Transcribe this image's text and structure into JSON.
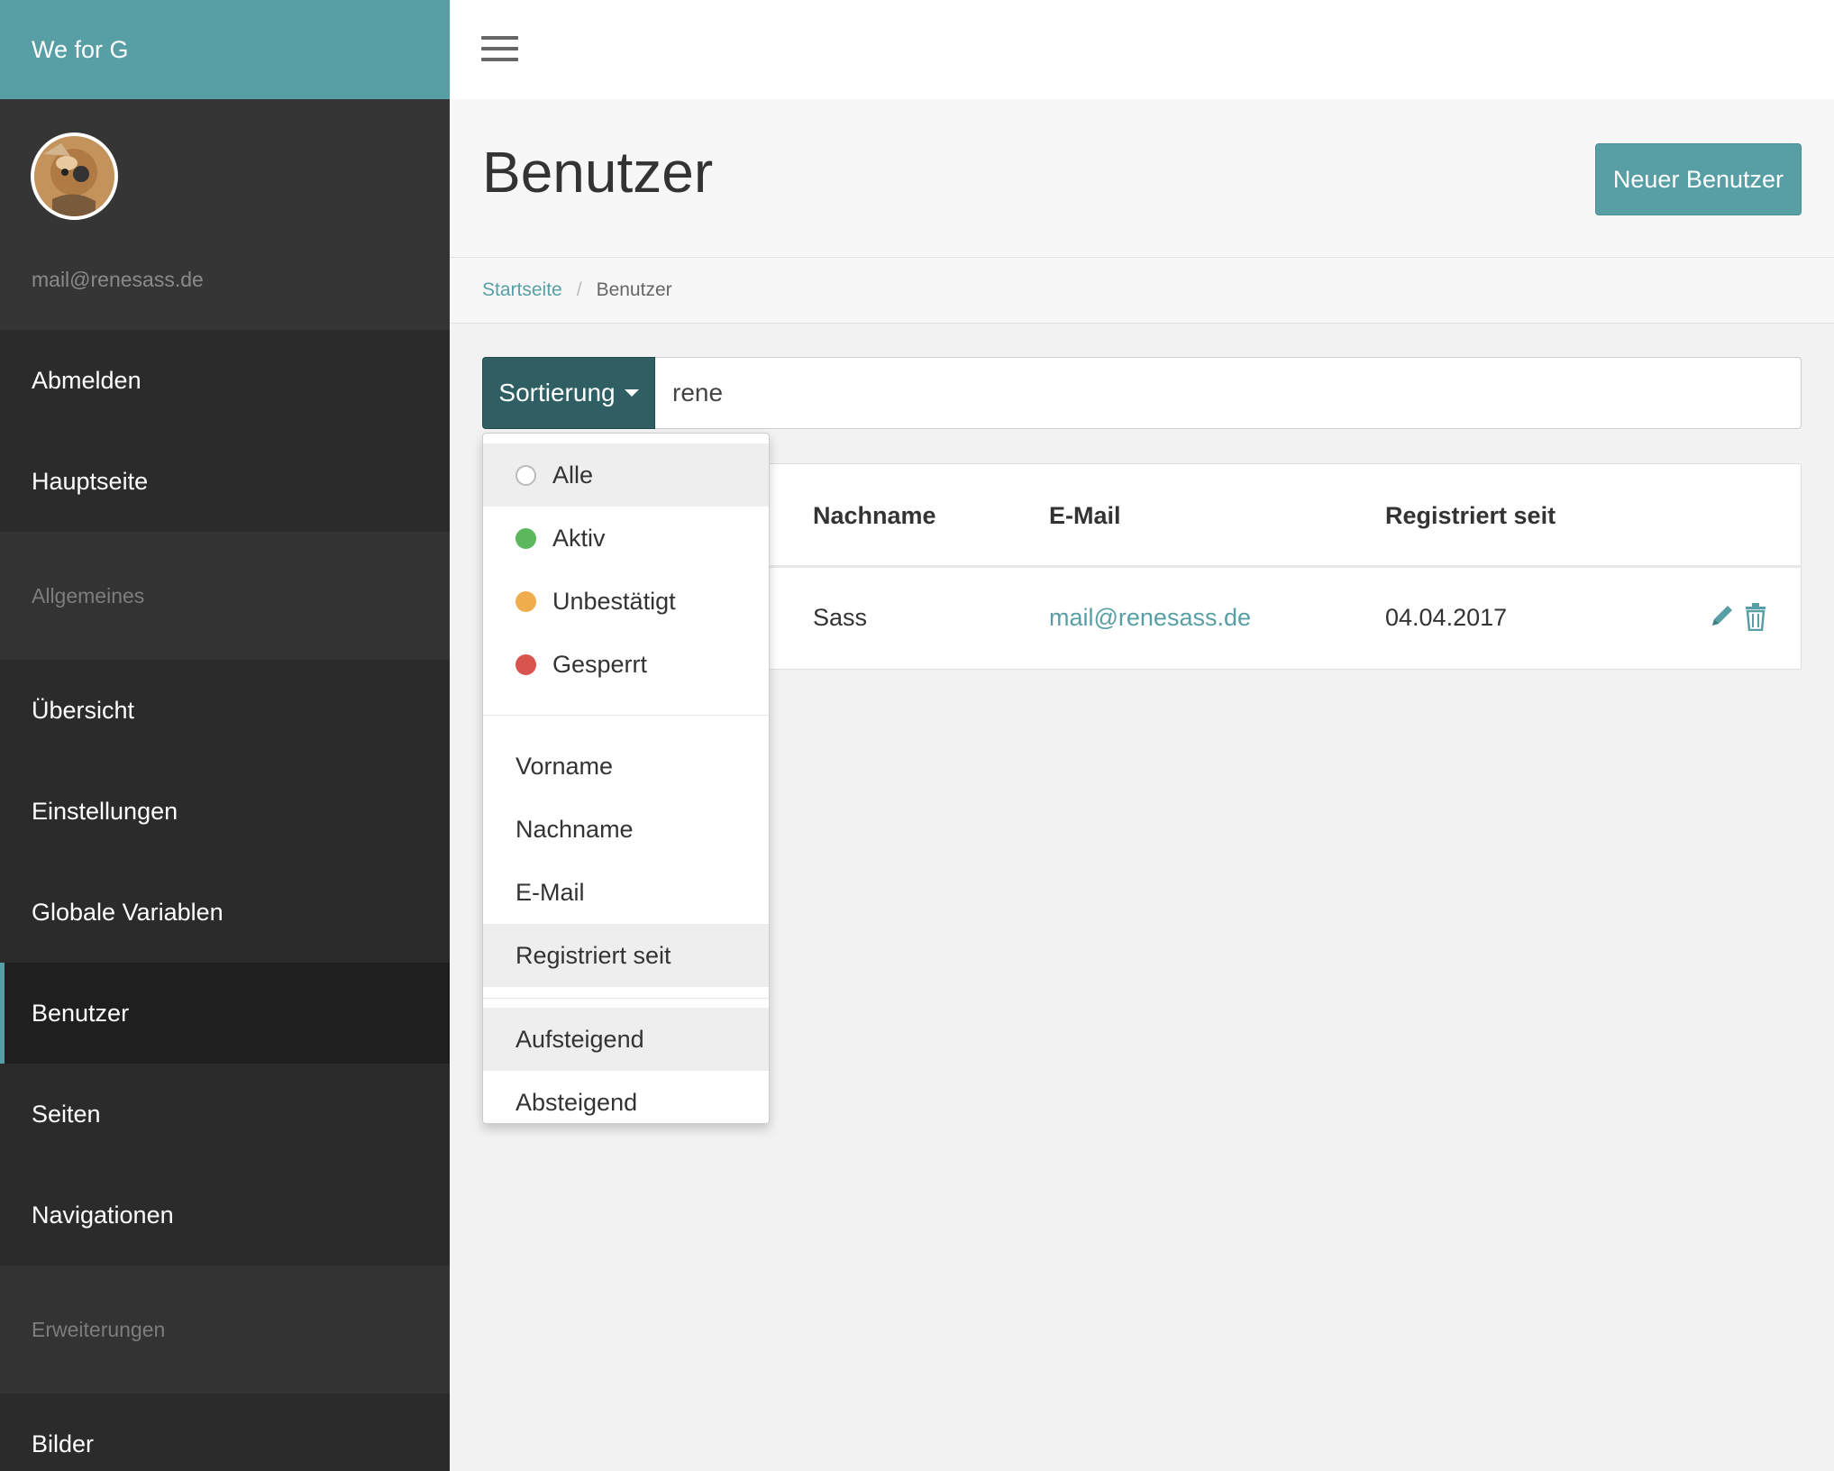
{
  "sidebar": {
    "brand": "We for G",
    "user_email": "mail@renesass.de",
    "top_items": [
      {
        "label": "Abmelden"
      },
      {
        "label": "Hauptseite"
      }
    ],
    "sections": [
      {
        "title": "Allgemeines",
        "items": [
          {
            "label": "Übersicht"
          },
          {
            "label": "Einstellungen"
          },
          {
            "label": "Globale Variablen"
          },
          {
            "label": "Benutzer",
            "active": true
          },
          {
            "label": "Seiten"
          },
          {
            "label": "Navigationen"
          }
        ]
      },
      {
        "title": "Erweiterungen",
        "items": [
          {
            "label": "Bilder"
          }
        ]
      }
    ]
  },
  "header": {
    "title": "Benutzer",
    "new_button": "Neuer Benutzer"
  },
  "breadcrumb": {
    "home": "Startseite",
    "separator": "/",
    "current": "Benutzer"
  },
  "search": {
    "sort_label": "Sortierung",
    "value": "rene"
  },
  "table": {
    "columns": [
      "Nachname",
      "E-Mail",
      "Registriert seit"
    ],
    "rows": [
      {
        "nachname": "Sass",
        "email": "mail@renesass.de",
        "registriert": "04.04.2017"
      }
    ]
  },
  "dropdown": {
    "status_options": [
      {
        "label": "Alle",
        "color": "none",
        "highlighted": true
      },
      {
        "label": "Aktiv",
        "color": "#5cb85c"
      },
      {
        "label": "Unbestätigt",
        "color": "#f0ad4e"
      },
      {
        "label": "Gesperrt",
        "color": "#d9534f"
      }
    ],
    "sort_fields": [
      {
        "label": "Vorname"
      },
      {
        "label": "Nachname"
      },
      {
        "label": "E-Mail"
      },
      {
        "label": "Registriert seit",
        "highlighted": true
      }
    ],
    "sort_orders": [
      {
        "label": "Aufsteigend",
        "highlighted": true
      },
      {
        "label": "Absteigend"
      }
    ]
  },
  "colors": {
    "accent": "#579fa5",
    "sidebar": "#2b2b2b",
    "sort_button": "#2f5f63"
  }
}
